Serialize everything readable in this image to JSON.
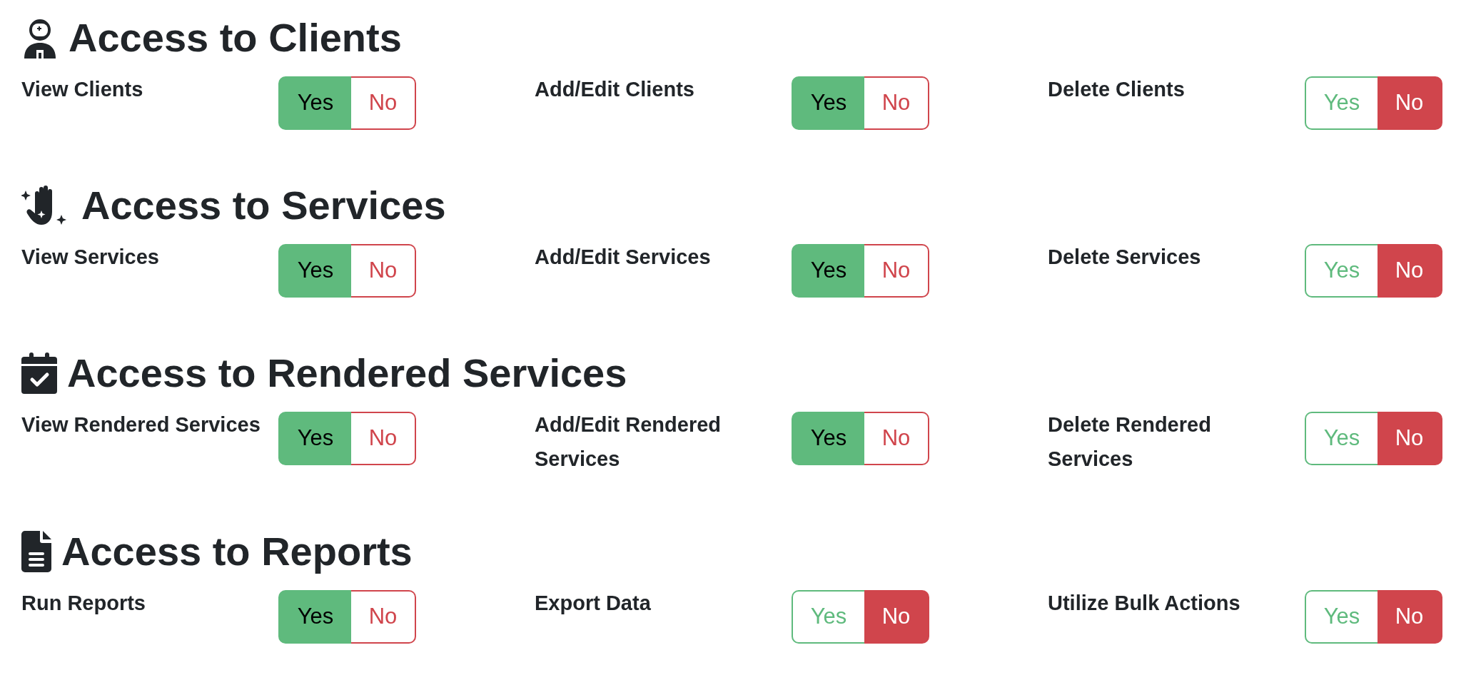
{
  "sections": [
    {
      "title": "Access to Clients",
      "permissions": [
        {
          "label": "View Clients",
          "options": [
            {
              "label": "Yes",
              "selected": true
            },
            {
              "label": "No",
              "selected": false
            }
          ]
        },
        {
          "label": "Add/Edit Clients",
          "options": [
            {
              "label": "Yes",
              "selected": true
            },
            {
              "label": "No",
              "selected": false
            }
          ]
        },
        {
          "label": "Delete Clients",
          "options": [
            {
              "label": "Yes",
              "selected": false
            },
            {
              "label": "No",
              "selected": true
            }
          ]
        }
      ]
    },
    {
      "title": "Access to Services",
      "permissions": [
        {
          "label": "View Services",
          "options": [
            {
              "label": "Yes",
              "selected": true
            },
            {
              "label": "No",
              "selected": false
            }
          ]
        },
        {
          "label": "Add/Edit Services",
          "options": [
            {
              "label": "Yes",
              "selected": true
            },
            {
              "label": "No",
              "selected": false
            }
          ]
        },
        {
          "label": "Delete Services",
          "options": [
            {
              "label": "Yes",
              "selected": false
            },
            {
              "label": "No",
              "selected": true
            }
          ]
        }
      ]
    },
    {
      "title": "Access to Rendered Services",
      "permissions": [
        {
          "label": "View Rendered Services",
          "options": [
            {
              "label": "Yes",
              "selected": true
            },
            {
              "label": "No",
              "selected": false
            }
          ]
        },
        {
          "label": "Add/Edit Rendered Services",
          "options": [
            {
              "label": "Yes",
              "selected": true
            },
            {
              "label": "No",
              "selected": false
            }
          ]
        },
        {
          "label": "Delete Rendered Services",
          "options": [
            {
              "label": "Yes",
              "selected": false
            },
            {
              "label": "No",
              "selected": true
            }
          ]
        }
      ]
    },
    {
      "title": "Access to Reports",
      "permissions": [
        {
          "label": "Run Reports",
          "options": [
            {
              "label": "Yes",
              "selected": true
            },
            {
              "label": "No",
              "selected": false
            }
          ]
        },
        {
          "label": "Export Data",
          "options": [
            {
              "label": "Yes",
              "selected": false
            },
            {
              "label": "No",
              "selected": true
            }
          ]
        },
        {
          "label": "Utilize Bulk Actions",
          "options": [
            {
              "label": "Yes",
              "selected": false
            },
            {
              "label": "No",
              "selected": true
            }
          ]
        }
      ]
    }
  ]
}
